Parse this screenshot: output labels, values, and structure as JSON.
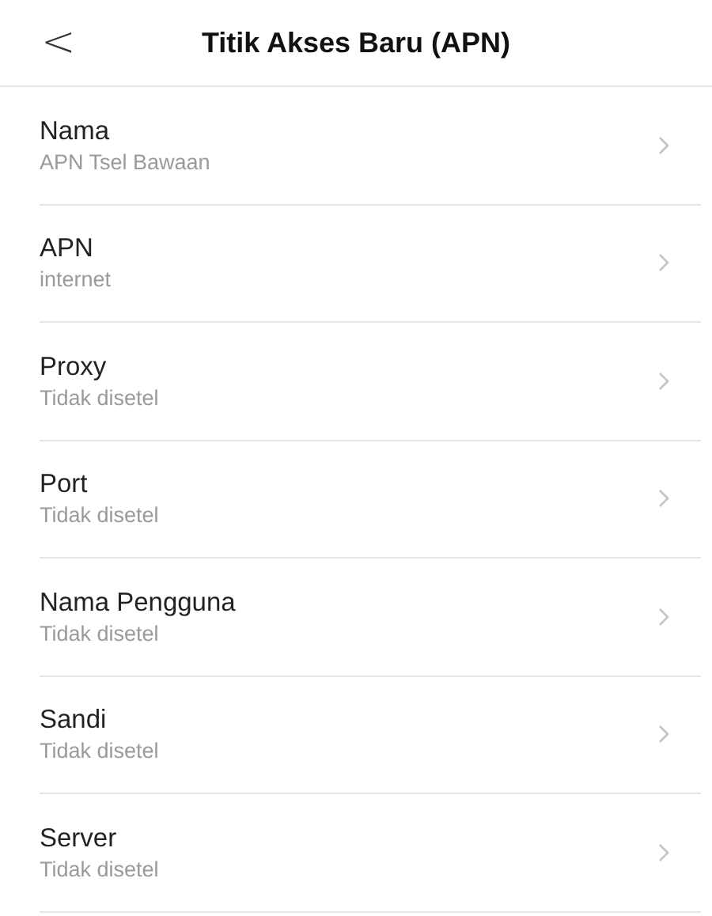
{
  "header": {
    "back": "<",
    "title": "Titik Akses Baru (APN)"
  },
  "items": [
    {
      "label": "Nama",
      "value": "APN Tsel Bawaan"
    },
    {
      "label": "APN",
      "value": "internet"
    },
    {
      "label": "Proxy",
      "value": "Tidak disetel"
    },
    {
      "label": "Port",
      "value": "Tidak disetel"
    },
    {
      "label": "Nama Pengguna",
      "value": "Tidak disetel"
    },
    {
      "label": "Sandi",
      "value": "Tidak disetel"
    },
    {
      "label": "Server",
      "value": "Tidak disetel"
    }
  ]
}
